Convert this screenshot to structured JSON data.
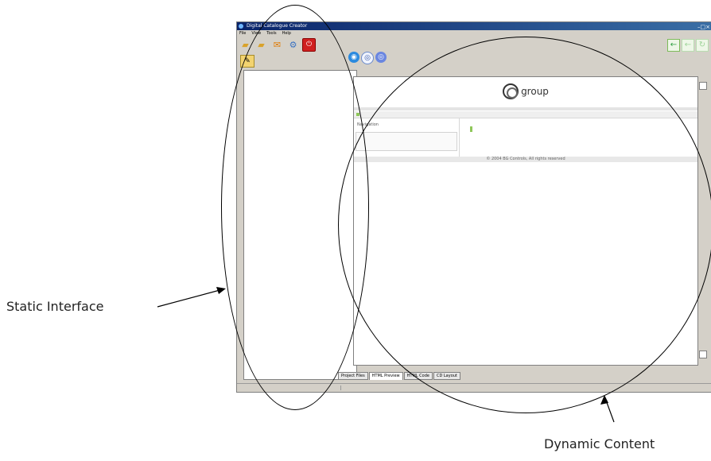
{
  "app": {
    "title": "Digital Catalogue Creator",
    "controls": "–□×",
    "menu": [
      "File",
      "View",
      "Tools",
      "Help"
    ]
  },
  "toolbar": {
    "icons": [
      "folder-open-icon",
      "save-icon",
      "email-icon",
      "settings-icon",
      "stop-icon"
    ],
    "right_icons": [
      "back-arrow-icon",
      "forward-arrow-icon",
      "refresh-icon"
    ]
  },
  "left_panel": {
    "tool_icon": "pencil-icon"
  },
  "preview": {
    "toolbar_icons": [
      "globe-icon",
      "cd-icon",
      "disc-icon"
    ],
    "logo_text": "group",
    "navigation_label": "Navigation",
    "copyright": "© 2004 BG Controls, All rights reserved"
  },
  "tabs": [
    "Project Files",
    "HTML Preview",
    "HTML Code",
    "CD Layout"
  ],
  "annotations": {
    "static_interface": "Static Interface",
    "dynamic_content": "Dynamic Content"
  },
  "colors": {
    "titlebar_start": "#0a246a",
    "titlebar_end": "#3a6ea5",
    "accent_green": "#8fc75a",
    "stop_red": "#d02020"
  }
}
